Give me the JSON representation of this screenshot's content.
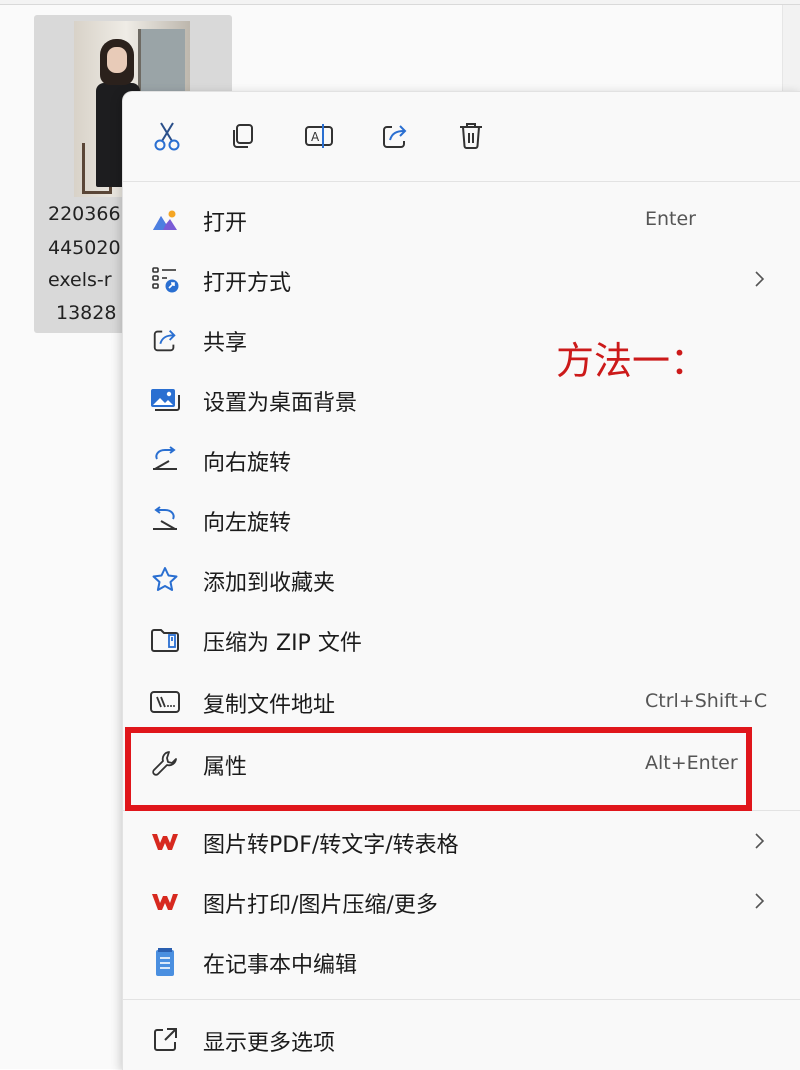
{
  "file": {
    "name_lines": [
      "220366",
      "445020",
      "exels-r",
      "13828"
    ]
  },
  "toolbar": {
    "cut": "cut-icon",
    "copy": "copy-icon",
    "rename": "rename-icon",
    "share": "share-icon",
    "delete": "delete-icon"
  },
  "menu": {
    "open": {
      "label": "打开",
      "shortcut": "Enter"
    },
    "open_with": {
      "label": "打开方式"
    },
    "share": {
      "label": "共享"
    },
    "set_wallpaper": {
      "label": "设置为桌面背景"
    },
    "rotate_right": {
      "label": "向右旋转"
    },
    "rotate_left": {
      "label": "向左旋转"
    },
    "add_favorites": {
      "label": "添加到收藏夹"
    },
    "compress_zip": {
      "label": "压缩为 ZIP 文件"
    },
    "copy_path": {
      "label": "复制文件地址",
      "shortcut": "Ctrl+Shift+C"
    },
    "properties": {
      "label": "属性",
      "shortcut": "Alt+Enter"
    },
    "wps_pdf": {
      "label": "图片转PDF/转文字/转表格"
    },
    "wps_print": {
      "label": "图片打印/图片压缩/更多"
    },
    "notepad_edit": {
      "label": "在记事本中编辑"
    },
    "more_options": {
      "label": "显示更多选项"
    }
  },
  "annotation": {
    "text": "方法一："
  },
  "colors": {
    "highlight": "#e0161b",
    "annotation": "#cc1a1a",
    "accent": "#0067c0",
    "wps": "#d7291f"
  }
}
